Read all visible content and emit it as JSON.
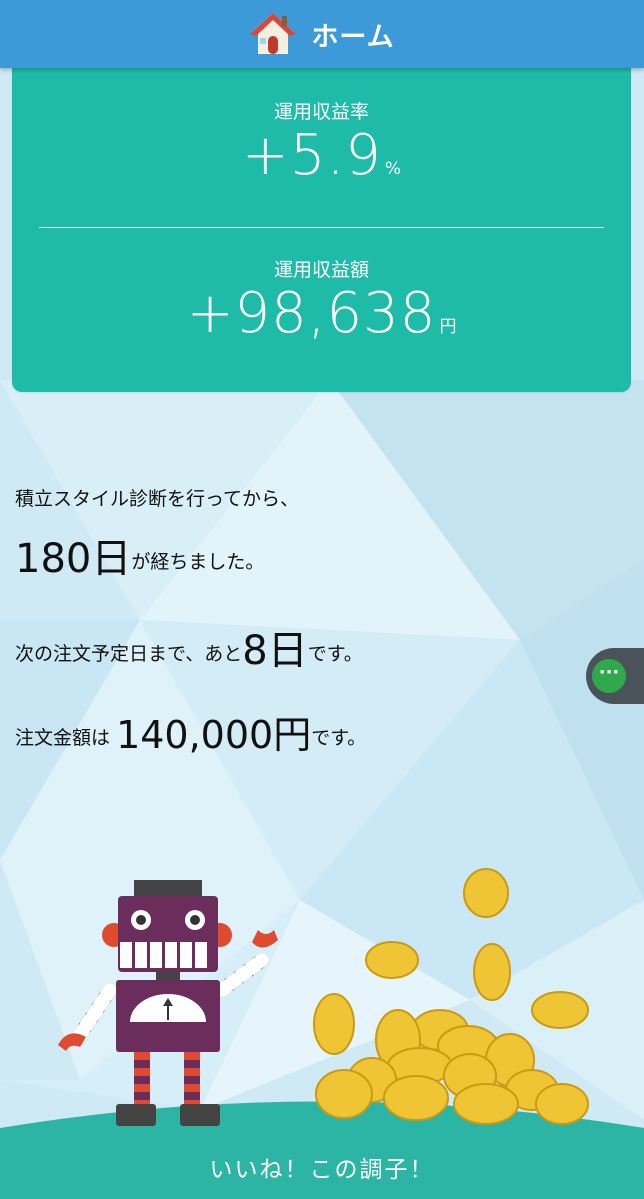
{
  "header": {
    "title": "ホーム",
    "icon": "house-icon",
    "bg_color": "#3d9ad8"
  },
  "summary_card": {
    "bg_color": "#1ebca8",
    "rate_label": "運用収益率",
    "rate_value": "+5.9",
    "rate_unit": "%",
    "amount_label": "運用収益額",
    "amount_value": "+98,638",
    "amount_unit": "円"
  },
  "info": {
    "line1": "積立スタイル診断を行ってから、",
    "days_elapsed": "180日",
    "line2_suffix": "が経ちました。",
    "line3_prefix": "次の注文予定日まで、あと",
    "days_to_order": "8日",
    "line3_suffix": "です。",
    "line4_prefix": "注文金額は",
    "order_amount": "140,000円",
    "line4_suffix": "です。"
  },
  "side_menu": {
    "icon": "more-dots-icon",
    "label": "···"
  },
  "footer": {
    "message": "いいね！この調子！",
    "hill_color": "#2cb5a4"
  }
}
